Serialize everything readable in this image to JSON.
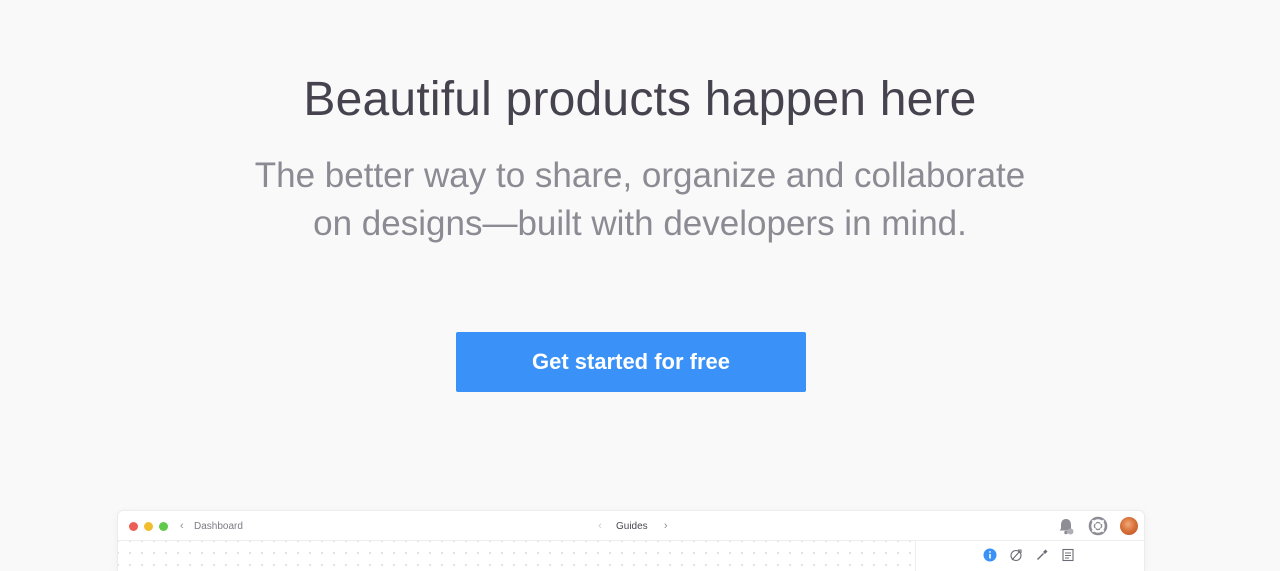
{
  "hero": {
    "title": "Beautiful products happen here",
    "subtitle": "The better way to share, organize and collaborate on designs—built with developers in mind.",
    "cta_label": "Get started for free"
  },
  "app_window": {
    "back_label": "Dashboard",
    "section_title": "Guides",
    "icons": [
      "bell-icon",
      "help-icon",
      "avatar"
    ],
    "inspector_tabs": [
      "info-icon",
      "compass-icon",
      "eyedropper-icon",
      "notes-icon"
    ]
  },
  "colors": {
    "accent": "#3a91f7",
    "title": "#46434f",
    "subtitle": "#8c8a92",
    "background": "#f9f9f9"
  }
}
